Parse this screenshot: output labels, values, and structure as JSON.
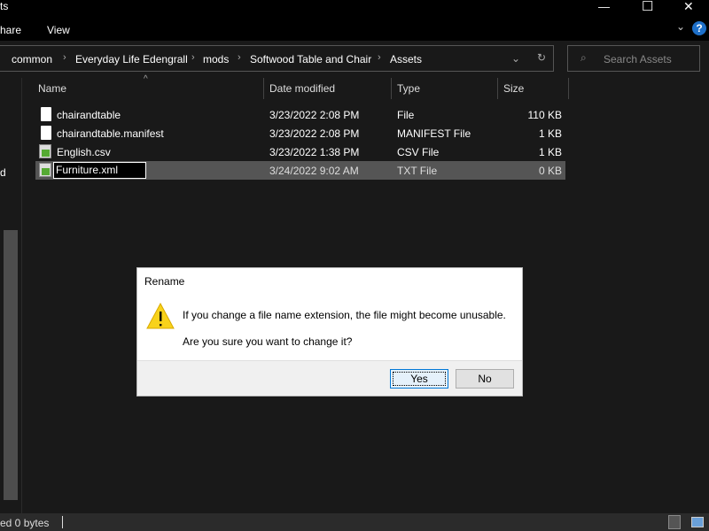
{
  "window": {
    "title": "ts",
    "minimize": "—",
    "maximize": "☐",
    "close": "✕"
  },
  "ribbon": {
    "tabs": [
      "hare",
      "View"
    ],
    "help": "?",
    "expand": "⌄"
  },
  "address": {
    "crumbs": [
      "common",
      "Everyday Life Edengrall",
      "mods",
      "Softwood Table and Chair",
      "Assets"
    ],
    "search_placeholder": "Search Assets"
  },
  "columns": {
    "name": "Name",
    "date": "Date modified",
    "type": "Type",
    "size": "Size"
  },
  "files": [
    {
      "name": "chairandtable",
      "date": "3/23/2022 2:08 PM",
      "type": "File",
      "size": "110 KB",
      "icon": "file"
    },
    {
      "name": "chairandtable.manifest",
      "date": "3/23/2022 2:08 PM",
      "type": "MANIFEST File",
      "size": "1 KB",
      "icon": "file"
    },
    {
      "name": "English.csv",
      "date": "3/23/2022 1:38 PM",
      "type": "CSV File",
      "size": "1 KB",
      "icon": "text"
    },
    {
      "name": "Furniture.xml",
      "date": "3/24/2022 9:02 AM",
      "type": "TXT File",
      "size": "0 KB",
      "icon": "text"
    }
  ],
  "nav": {
    "partial_label": "d"
  },
  "status": {
    "text": "ed  0 bytes"
  },
  "dialog": {
    "title": "Rename",
    "message": "If you change a file name extension, the file might become unusable.",
    "question": "Are you sure you want to change it?",
    "yes": "Yes",
    "no": "No"
  }
}
